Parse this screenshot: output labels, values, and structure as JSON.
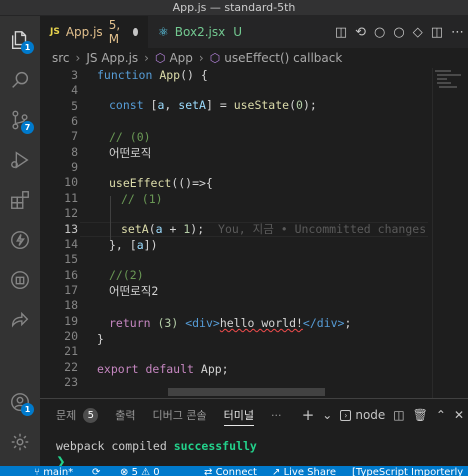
{
  "window": {
    "title": "App.js — standard-5th"
  },
  "activity_bar": {
    "explorer_badge": "1",
    "source_control_badge": "7",
    "accounts_badge": "1"
  },
  "tabs": [
    {
      "icon": "JS",
      "label": "App.js",
      "status": "5, M",
      "active": true
    },
    {
      "icon": "react",
      "label": "Box2.jsx",
      "status": "U",
      "active": false
    }
  ],
  "breadcrumb": {
    "items": [
      "src",
      "JS App.js",
      "App",
      "useEffect() callback"
    ]
  },
  "editor": {
    "line_numbers": [
      "3",
      "4",
      "5",
      "6",
      "7",
      "8",
      "9",
      "10",
      "11",
      "12",
      "13",
      "14",
      "15",
      "16",
      "17",
      "18",
      "19",
      "20",
      "21",
      "22",
      "23"
    ],
    "current_line": "13",
    "lines": {
      "l3": {
        "kw": "function",
        "fn": "App",
        "rest": "() {"
      },
      "l5": {
        "kw": "const",
        "open": " [",
        "v1": "a",
        "comma": ", ",
        "v2": "setA",
        "close": "] = ",
        "fn": "useState",
        "p1": "(",
        "num": "0",
        "p2": ");"
      },
      "l7": "// (0)",
      "l8": "어떤로직",
      "l10": {
        "fn": "useEffect",
        "rest": "(()=>{"
      },
      "l11": "// (1)",
      "l13": {
        "fn": "setA",
        "p1": "(",
        "v": "a",
        "op": " + ",
        "num": "1",
        "p2": ");",
        "ghost": "You, 지금 • Uncommitted changes"
      },
      "l14": {
        "rest": "}, [",
        "v": "a",
        "close": "])"
      },
      "l16": "//(2)",
      "l17": "어떤로직2",
      "l19": {
        "kw": "return",
        "num": "(3)",
        "open_tag": "<div>",
        "text": "hello world!",
        "close_tag": "</div>",
        "semi": ";"
      },
      "l20": "}",
      "l22": {
        "kw1": "export",
        "kw2": "default",
        "name": "App",
        "semi": ";"
      }
    }
  },
  "panel": {
    "tabs": [
      {
        "label": "문제",
        "count": "5"
      },
      {
        "label": "출력"
      },
      {
        "label": "디버그 콘솔"
      },
      {
        "label": "터미널",
        "active": true
      }
    ],
    "more": "···",
    "add": "+",
    "terminal_name": "node",
    "terminal_text": "webpack compiled ",
    "terminal_success": "successfully",
    "prompt": "❯"
  },
  "statusbar": {
    "branch": "main*",
    "errors": "5",
    "warnings": "0",
    "connect": "Connect",
    "live_share": "Live Share",
    "typescript": "[TypeScript Importerly"
  },
  "colors": {
    "accent": "#007acc",
    "modified": "#e2c08d",
    "untracked": "#73c991"
  }
}
